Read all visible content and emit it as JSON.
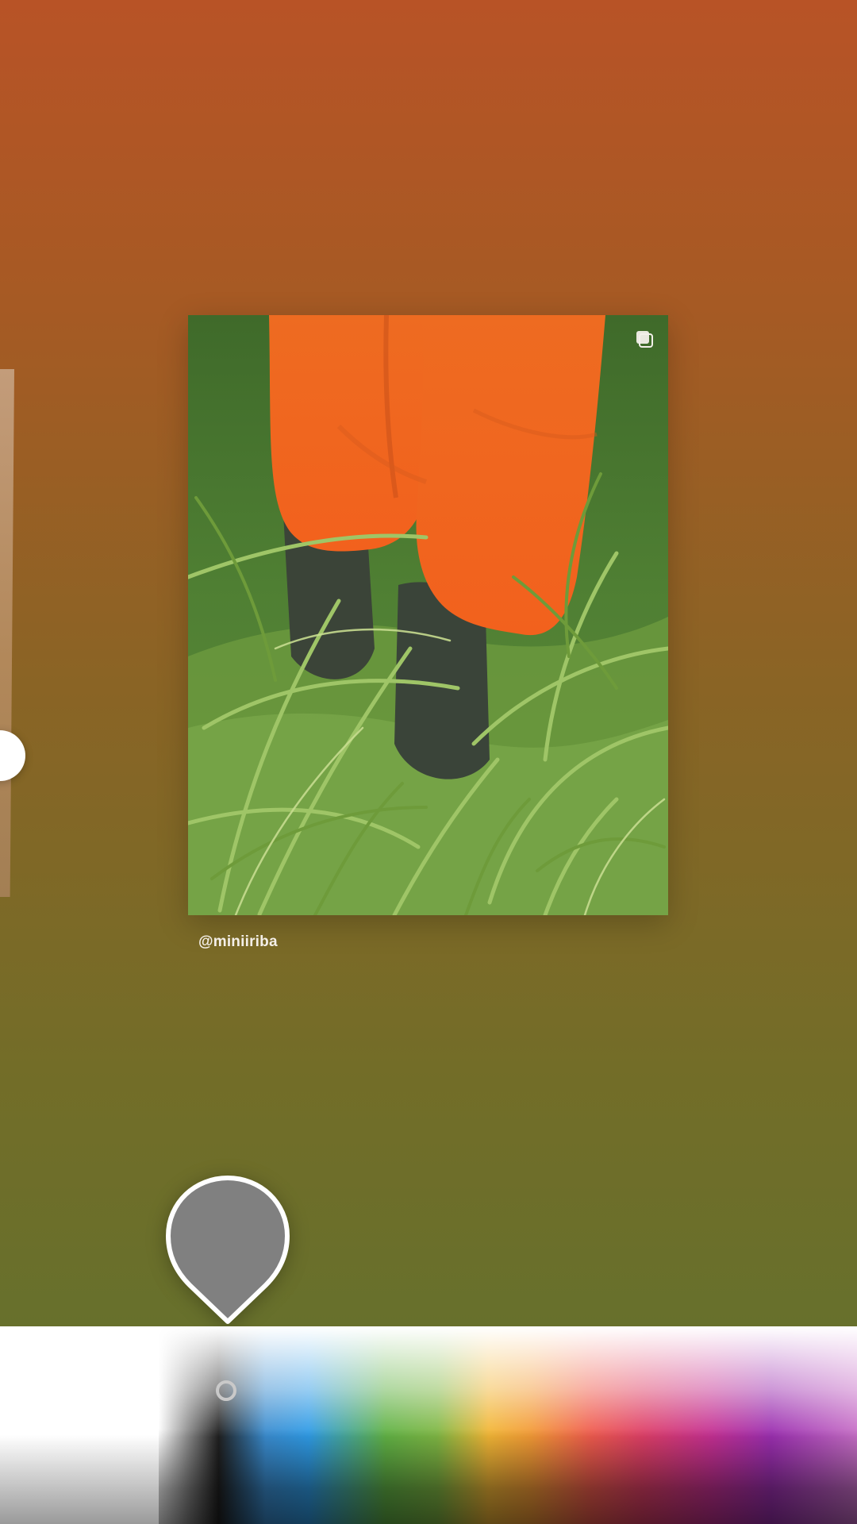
{
  "story_editor": {
    "post": {
      "username": "@miniiriba",
      "image_description_icon": "multiple-photos-icon"
    },
    "draw_tool": {
      "selected_color": "#808080",
      "size_slider_value": 0.5
    },
    "palette": {
      "cursor_color": "#c9c9c9"
    }
  }
}
